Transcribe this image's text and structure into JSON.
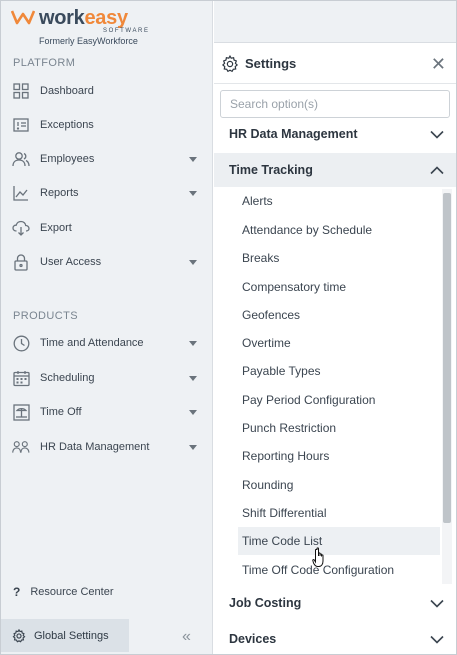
{
  "logo": {
    "brand_left": "work",
    "brand_right": "easy",
    "tagline": "SOFTWARE",
    "formerly": "Formerly EasyWorkforce",
    "colors": {
      "brand": "#3a4a5c",
      "accent": "#f0883a"
    }
  },
  "sidebar": {
    "platform_title": "PLATFORM",
    "platform_items": [
      {
        "label": "Dashboard",
        "icon": "grid-icon",
        "has_caret": false
      },
      {
        "label": "Exceptions",
        "icon": "exceptions-icon",
        "has_caret": false
      },
      {
        "label": "Employees",
        "icon": "people-icon",
        "has_caret": true
      },
      {
        "label": "Reports",
        "icon": "chart-line-icon",
        "has_caret": true
      },
      {
        "label": "Export",
        "icon": "cloud-export-icon",
        "has_caret": false
      },
      {
        "label": "User Access",
        "icon": "lock-icon",
        "has_caret": true
      }
    ],
    "products_title": "PRODUCTS",
    "product_items": [
      {
        "label": "Time and Attendance",
        "icon": "clock-icon",
        "has_caret": true
      },
      {
        "label": "Scheduling",
        "icon": "calendar-icon",
        "has_caret": true
      },
      {
        "label": "Time Off",
        "icon": "time-off-icon",
        "has_caret": true
      },
      {
        "label": "HR Data Management",
        "icon": "hr-people-icon",
        "has_caret": true
      }
    ],
    "resource_center": "Resource Center",
    "global_settings": "Global Settings",
    "collapse_icon": "double-chevron-left-icon"
  },
  "settings": {
    "title": "Settings",
    "close_icon": "close-icon",
    "search_placeholder": "Search option(s)",
    "groups": {
      "hr": {
        "label": "HR Data Management",
        "expanded": false
      },
      "time_tracking": {
        "label": "Time Tracking",
        "expanded": true
      },
      "job_costing": {
        "label": "Job Costing",
        "expanded": false
      },
      "devices": {
        "label": "Devices",
        "expanded": false
      }
    },
    "time_tracking_items": [
      "Alerts",
      "Attendance by Schedule",
      "Breaks",
      "Compensatory time",
      "Geofences",
      "Overtime",
      "Payable Types",
      "Pay Period Configuration",
      "Punch Restriction",
      "Reporting Hours",
      "Rounding",
      "Shift Differential",
      "Time Code List",
      "Time Off Code Configuration"
    ],
    "hovered_item": "Time Code List"
  }
}
